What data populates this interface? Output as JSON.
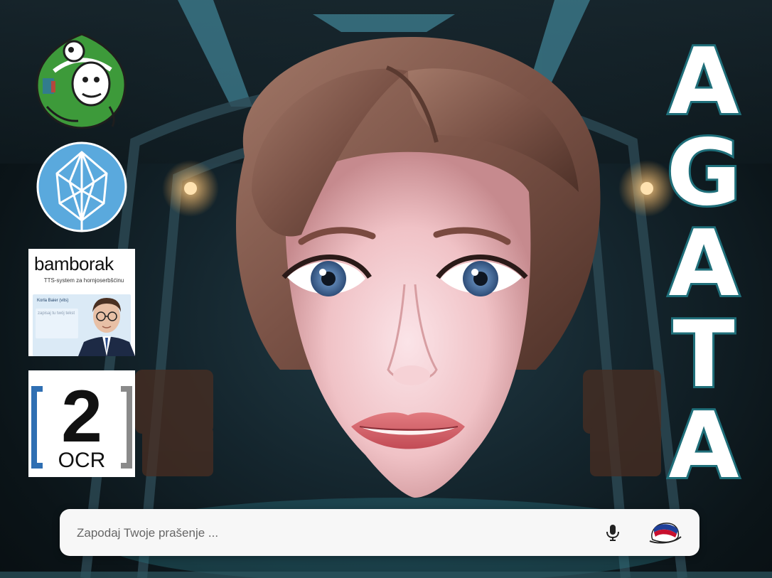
{
  "page": {
    "background": "spaceship-corridor-image",
    "accent_color": "#1f6f7a"
  },
  "logos": {
    "frog_logo": {
      "icon": "frog-mascot-logo-icon"
    },
    "leaf_logo": {
      "icon": "leaf-circle-logo-icon",
      "color": "#5aa9dd"
    },
    "bamborak": {
      "title": "bamborak",
      "subtitle": "TTS-system za hornjoserbšćinu",
      "voice": "Korla Baier (vits)",
      "placeholder": "zapisaj tu twój tekst"
    },
    "ocr": {
      "number": "2",
      "label": "OCR"
    }
  },
  "avatar": {
    "icon": "avatar-face-image"
  },
  "title_letters": [
    "A",
    "G",
    "A",
    "T",
    "A"
  ],
  "search": {
    "placeholder": "Zapodaj Twoje prašenje ...",
    "value": "",
    "mic_icon": "microphone-icon",
    "lang_icon": "sorbian-flag-icon"
  }
}
